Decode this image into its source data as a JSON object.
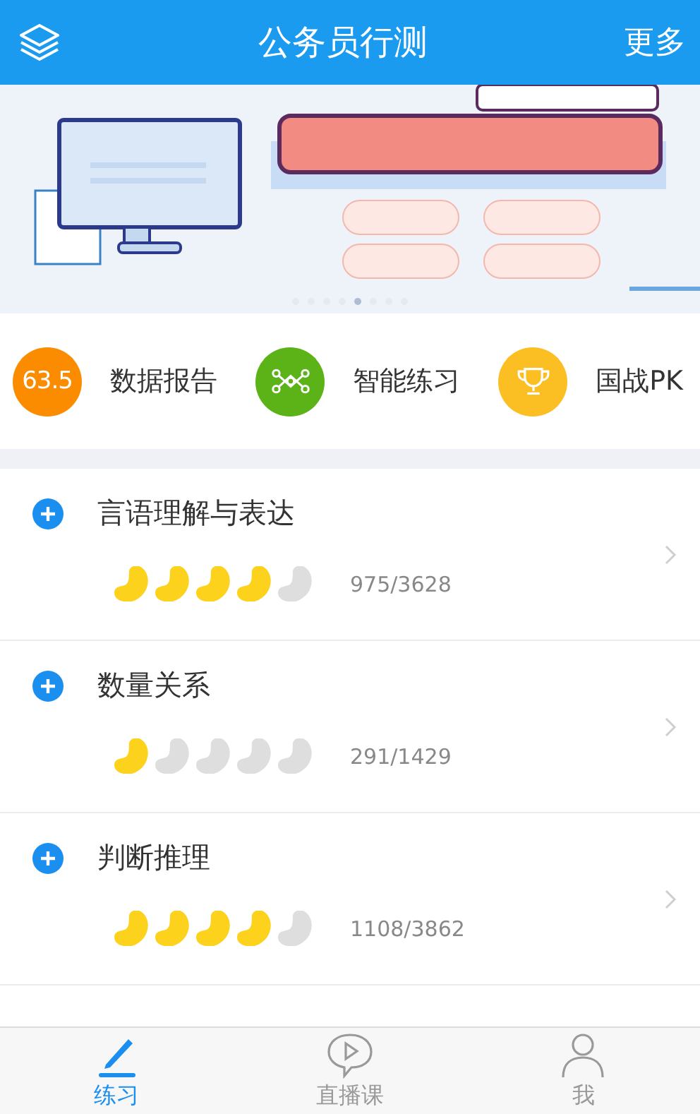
{
  "header": {
    "title": "公务员行测",
    "more": "更多"
  },
  "banner": {
    "kind": "picture",
    "pages": [
      {
        "selected": false
      },
      {
        "selected": false
      },
      {
        "selected": false
      },
      {
        "selected": false
      },
      {
        "selected": true
      },
      {
        "selected": false
      },
      {
        "selected": false
      },
      {
        "selected": false
      }
    ]
  },
  "shortcuts": [
    {
      "kind": "score",
      "badge": "63.5",
      "label": "数据报告",
      "color": "#fb8c00"
    },
    {
      "kind": "network",
      "label": "智能练习",
      "color": "#5bb318"
    },
    {
      "kind": "trophy",
      "label": "国战PK",
      "color": "#fbbf24"
    }
  ],
  "subjects": [
    {
      "name": "言语理解与表达",
      "stars": 4,
      "progress": "975/3628"
    },
    {
      "name": "数量关系",
      "stars": 1,
      "progress": "291/1429"
    },
    {
      "name": "判断推理",
      "stars": 4,
      "progress": "1108/3862"
    }
  ],
  "tabs": [
    {
      "kind": "pencil",
      "label": "练习",
      "selected": true
    },
    {
      "kind": "live",
      "label": "直播课",
      "selected": false
    },
    {
      "kind": "person",
      "label": "我",
      "selected": false
    }
  ]
}
